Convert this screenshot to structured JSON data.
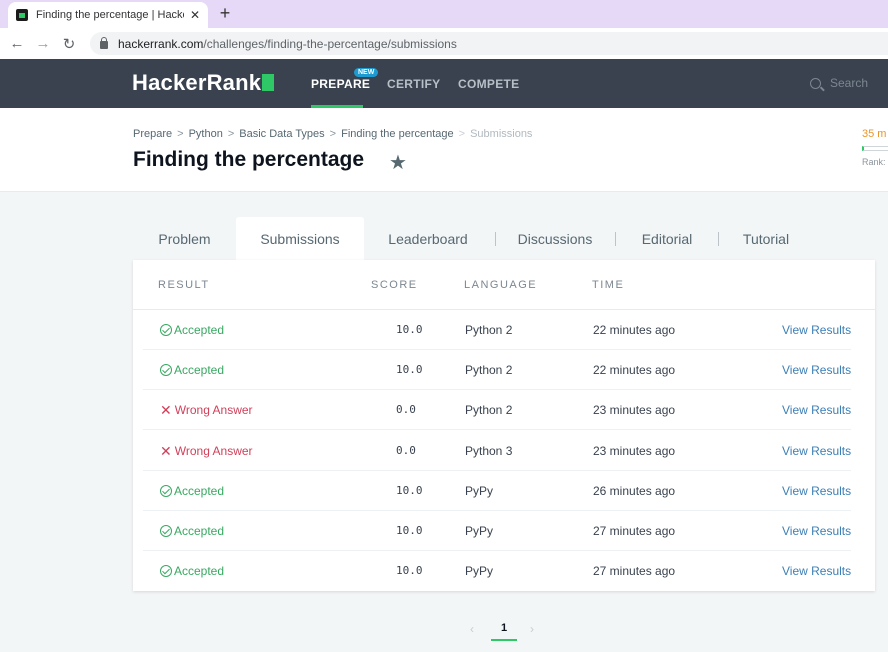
{
  "browser": {
    "tab_title": "Finding the percentage | HackerR",
    "tab_close": "✕",
    "new_tab": "+",
    "url_host": "hackerrank.com",
    "url_path": "/challenges/finding-the-percentage/submissions"
  },
  "nav": {
    "logo": "HackerRank",
    "links": {
      "prepare": "PREPARE",
      "certify": "CERTIFY",
      "compete": "COMPETE"
    },
    "new_badge": "NEW",
    "search_placeholder": "Search"
  },
  "header": {
    "breadcrumb": [
      "Prepare",
      "Python",
      "Basic Data Types",
      "Finding the percentage",
      "Submissions"
    ],
    "title": "Finding the percentage",
    "side_points": "35 m",
    "side_rank": "Rank:"
  },
  "tabs": [
    "Problem",
    "Submissions",
    "Leaderboard",
    "Discussions",
    "Editorial",
    "Tutorial"
  ],
  "active_tab": "Submissions",
  "table": {
    "headers": {
      "result": "RESULT",
      "score": "SCORE",
      "language": "LANGUAGE",
      "time": "TIME"
    },
    "rows": [
      {
        "status": "ok",
        "result": "Accepted",
        "score": "10.0",
        "language": "Python 2",
        "time": "22 minutes ago",
        "action": "View Results"
      },
      {
        "status": "ok",
        "result": "Accepted",
        "score": "10.0",
        "language": "Python 2",
        "time": "22 minutes ago",
        "action": "View Results"
      },
      {
        "status": "bad",
        "result": "Wrong Answer",
        "score": "0.0",
        "language": "Python 2",
        "time": "23 minutes ago",
        "action": "View Results"
      },
      {
        "status": "bad",
        "result": "Wrong Answer",
        "score": "0.0",
        "language": "Python 3",
        "time": "23 minutes ago",
        "action": "View Results"
      },
      {
        "status": "ok",
        "result": "Accepted",
        "score": "10.0",
        "language": "PyPy",
        "time": "26 minutes ago",
        "action": "View Results"
      },
      {
        "status": "ok",
        "result": "Accepted",
        "score": "10.0",
        "language": "PyPy",
        "time": "27 minutes ago",
        "action": "View Results"
      },
      {
        "status": "ok",
        "result": "Accepted",
        "score": "10.0",
        "language": "PyPy",
        "time": "27 minutes ago",
        "action": "View Results"
      }
    ]
  },
  "pagination": {
    "prev": "‹",
    "current": "1",
    "next": "›"
  },
  "colors": {
    "accent_green": "#2ec866",
    "nav_bg": "#39424e",
    "error_red": "#d0405a",
    "link_blue": "#3c7fb5"
  }
}
